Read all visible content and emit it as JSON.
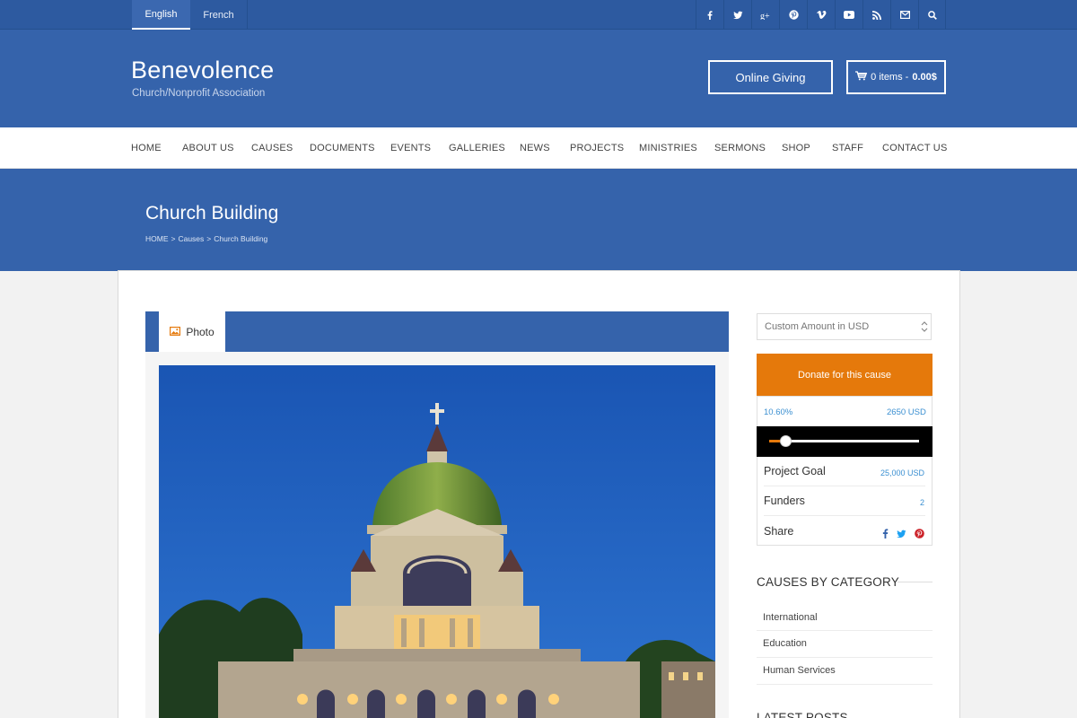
{
  "topbar": {
    "languages": [
      "English",
      "French"
    ],
    "active_language": "English",
    "social_icons": [
      "facebook-icon",
      "twitter-icon",
      "google-plus-icon",
      "pinterest-icon",
      "vimeo-icon",
      "youtube-icon",
      "rss-icon",
      "email-icon",
      "search-icon"
    ]
  },
  "header": {
    "title": "Benevolence",
    "tagline": "Church/Nonprofit Association",
    "giving_label": "Online Giving",
    "cart_items": "0 items -",
    "cart_total": "0.00$"
  },
  "nav": {
    "items": [
      "HOME",
      "ABOUT US",
      "CAUSES",
      "DOCUMENTS",
      "EVENTS",
      "GALLERIES",
      "NEWS",
      "PROJECTS",
      "MINISTRIES",
      "SERMONS",
      "SHOP",
      "STAFF",
      "CONTACT US"
    ]
  },
  "page": {
    "title": "Church Building",
    "breadcrumb": [
      "HOME",
      ">",
      "Causes",
      ">",
      "Church Building"
    ]
  },
  "media": {
    "tab_label": "Photo"
  },
  "donation": {
    "amount_placeholder": "Custom Amount in USD",
    "donate_label": "Donate for this cause",
    "percent_label": "10.60%",
    "progress_fraction": 0.106,
    "raised_label": "2650 USD",
    "goal_label": "Project Goal",
    "goal_value": "25,000 USD",
    "funders_label": "Funders",
    "funders_value": "2",
    "share_label": "Share"
  },
  "sidebar": {
    "categories_heading": "CAUSES BY CATEGORY",
    "categories": [
      "International",
      "Education",
      "Human Services"
    ],
    "latest_heading": "LATEST POSTS"
  },
  "colors": {
    "brand_blue": "#3563ab",
    "topbar_blue": "#2d5aa0",
    "donate_orange": "#e5790b",
    "link_blue": "#3a8fd1"
  }
}
